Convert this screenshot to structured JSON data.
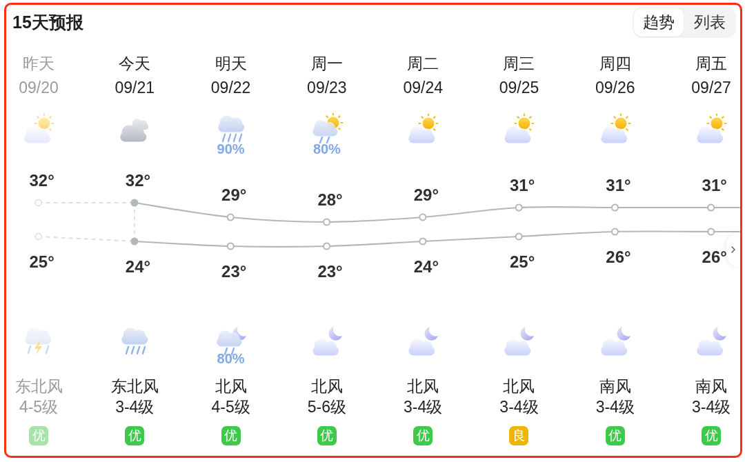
{
  "title": "15天预报",
  "view_tabs": [
    {
      "label": "趋势",
      "selected": true
    },
    {
      "label": "列表",
      "selected": false
    }
  ],
  "days": [
    {
      "name": "昨天",
      "date": "09/20",
      "past": true,
      "today": false,
      "day_weather": {
        "kind": "sun_cloud"
      },
      "high": "32°",
      "low": "25°",
      "night_weather": {
        "kind": "thunder_shower"
      },
      "wind_direction": "东北风",
      "wind_level": "4-5级",
      "air_quality": {
        "label": "优",
        "color": "#a6e2aa"
      }
    },
    {
      "name": "今天",
      "date": "09/21",
      "past": false,
      "today": true,
      "day_weather": {
        "kind": "overcast"
      },
      "high": "32°",
      "low": "24°",
      "night_weather": {
        "kind": "rain"
      },
      "wind_direction": "东北风",
      "wind_level": "3-4级",
      "air_quality": {
        "label": "优",
        "color": "#3ec84c"
      }
    },
    {
      "name": "明天",
      "date": "09/22",
      "past": false,
      "today": false,
      "day_weather": {
        "kind": "rain",
        "precipitation": "90%"
      },
      "high": "29°",
      "low": "23°",
      "night_weather": {
        "kind": "moon_rain",
        "precipitation": "80%"
      },
      "wind_direction": "北风",
      "wind_level": "4-5级",
      "air_quality": {
        "label": "优",
        "color": "#3ec84c"
      }
    },
    {
      "name": "周一",
      "date": "09/23",
      "past": false,
      "today": false,
      "day_weather": {
        "kind": "sun_rain",
        "precipitation": "80%"
      },
      "high": "28°",
      "low": "23°",
      "night_weather": {
        "kind": "moon_cloud"
      },
      "wind_direction": "北风",
      "wind_level": "5-6级",
      "air_quality": {
        "label": "优",
        "color": "#3ec84c"
      }
    },
    {
      "name": "周二",
      "date": "09/24",
      "past": false,
      "today": false,
      "day_weather": {
        "kind": "sun_cloud"
      },
      "high": "29°",
      "low": "24°",
      "night_weather": {
        "kind": "moon_cloud"
      },
      "wind_direction": "北风",
      "wind_level": "3-4级",
      "air_quality": {
        "label": "优",
        "color": "#3ec84c"
      }
    },
    {
      "name": "周三",
      "date": "09/25",
      "past": false,
      "today": false,
      "day_weather": {
        "kind": "sun_cloud"
      },
      "high": "31°",
      "low": "25°",
      "night_weather": {
        "kind": "moon_cloud"
      },
      "wind_direction": "北风",
      "wind_level": "3-4级",
      "air_quality": {
        "label": "良",
        "color": "#efb60a"
      }
    },
    {
      "name": "周四",
      "date": "09/26",
      "past": false,
      "today": false,
      "day_weather": {
        "kind": "sun_cloud"
      },
      "high": "31°",
      "low": "26°",
      "night_weather": {
        "kind": "moon_cloud"
      },
      "wind_direction": "南风",
      "wind_level": "3-4级",
      "air_quality": {
        "label": "优",
        "color": "#3ec84c"
      }
    },
    {
      "name": "周五",
      "date": "09/27",
      "past": false,
      "today": false,
      "day_weather": {
        "kind": "sun_cloud"
      },
      "high": "31°",
      "low": "26°",
      "night_weather": {
        "kind": "moon_cloud"
      },
      "wind_direction": "南风",
      "wind_level": "3-4级",
      "air_quality": {
        "label": "优",
        "color": "#3ec84c"
      }
    }
  ]
}
